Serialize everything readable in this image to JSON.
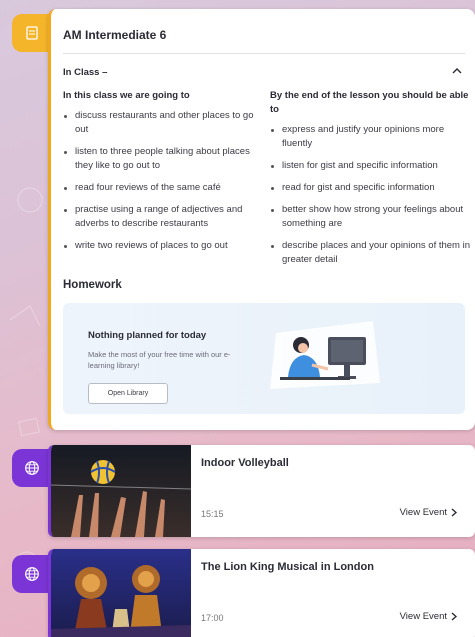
{
  "lesson": {
    "title": "AM Intermediate 6",
    "section_label": "In Class –",
    "left_heading": "In this class we are going to",
    "left_items": [
      "discuss restaurants and other places to go out",
      "listen to three people talking about places they like to go out to",
      "read four reviews of the same café",
      "practise using a range of adjectives and adverbs to describe restaurants",
      "write two reviews of places to go out"
    ],
    "right_heading": "By the end of the lesson you should be able to",
    "right_items": [
      "express and justify your opinions more fluently",
      "listen for gist and specific information",
      "read for gist and specific information",
      "better show how strong your feelings about something are",
      "describe places and your opinions of them in greater detail"
    ],
    "homework_title": "Homework",
    "homework": {
      "heading": "Nothing planned for today",
      "subtext": "Make the most of your free time with our e-learning library!",
      "button_label": "Open Library"
    }
  },
  "events": [
    {
      "title": "Indoor Volleyball",
      "time": "15:15",
      "link_label": "View Event"
    },
    {
      "title": "The Lion King Musical in London",
      "time": "17:00",
      "link_label": "View Event"
    }
  ],
  "colors": {
    "lesson_accent": "#f0a91d",
    "event_accent": "#7b35d6"
  }
}
